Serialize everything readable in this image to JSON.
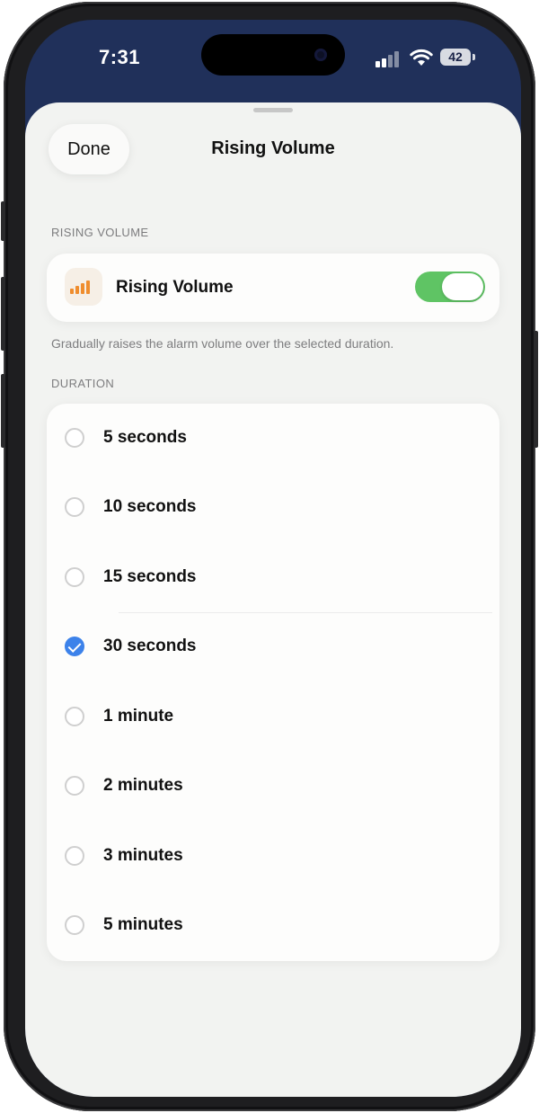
{
  "status_bar": {
    "time": "7:31",
    "battery": "42"
  },
  "nav": {
    "done_label": "Done",
    "title": "Rising Volume"
  },
  "rising_section": {
    "header": "RISING VOLUME",
    "toggle_label": "Rising Volume",
    "toggle_on": true,
    "footer": "Gradually raises the alarm volume over the selected duration."
  },
  "duration_section": {
    "header": "DURATION",
    "options": [
      {
        "label": "5 seconds",
        "selected": false
      },
      {
        "label": "10 seconds",
        "selected": false
      },
      {
        "label": "15 seconds",
        "selected": false
      },
      {
        "label": "30 seconds",
        "selected": true
      },
      {
        "label": "1 minute",
        "selected": false
      },
      {
        "label": "2 minutes",
        "selected": false
      },
      {
        "label": "3 minutes",
        "selected": false
      },
      {
        "label": "5 minutes",
        "selected": false
      }
    ]
  },
  "colors": {
    "accent": "#3c82ea",
    "toggle_on": "#5fc464",
    "icon": "#ef8d2e",
    "header_bg": "#20305a"
  }
}
